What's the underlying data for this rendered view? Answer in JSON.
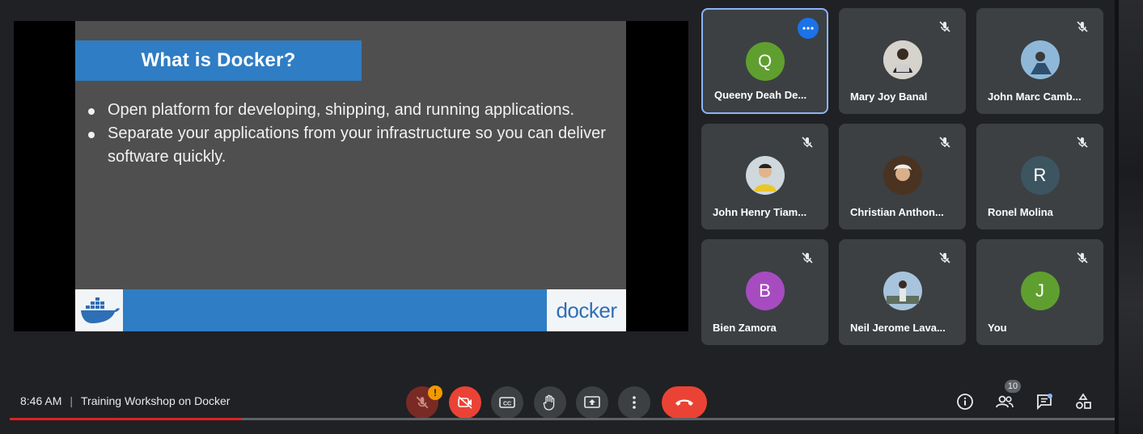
{
  "slide": {
    "title": "What is Docker?",
    "bullets": [
      "Open platform for developing, shipping, and running applications.",
      "Separate your applications from your infrastructure so you can deliver software quickly."
    ],
    "footer_logo_text": "docker",
    "colors": {
      "title_bar": "#2f7dc4",
      "background": "#4f4f4f"
    }
  },
  "participants": [
    {
      "name": "Queeny Deah De...",
      "initial": "Q",
      "avatar_color": "#5f9f2f",
      "speaking_focus": true
    },
    {
      "name": "Mary Joy Banal",
      "avatar": "photo-avatar",
      "muted": true
    },
    {
      "name": "John Marc Camb...",
      "avatar": "photo-avatar",
      "muted": true
    },
    {
      "name": "John Henry Tiam...",
      "avatar": "photo-avatar",
      "muted": true
    },
    {
      "name": "Christian Anthon...",
      "avatar": "photo-avatar",
      "muted": true
    },
    {
      "name": "Ronel Molina",
      "initial": "R",
      "avatar_color": "#3d5560",
      "muted": true
    },
    {
      "name": "Bien Zamora",
      "initial": "B",
      "avatar_color": "#a64cc0",
      "muted": true
    },
    {
      "name": "Neil Jerome Lava...",
      "avatar": "photo-avatar",
      "muted": true
    },
    {
      "name": "You",
      "initial": "J",
      "avatar_color": "#5f9f2f",
      "muted": true
    }
  ],
  "meeting": {
    "time": "8:46 AM",
    "separator": "|",
    "title": "Training Workshop on Docker"
  },
  "controls": {
    "mic_warning": "!",
    "participant_count": "10",
    "icons": [
      "mic-off-icon",
      "camera-off-icon",
      "captions-icon",
      "raise-hand-icon",
      "present-icon",
      "more-options-icon",
      "hang-up-icon"
    ],
    "right_icons": [
      "info-icon",
      "people-icon",
      "chat-icon",
      "activities-icon"
    ]
  },
  "video_progress": 0.21
}
